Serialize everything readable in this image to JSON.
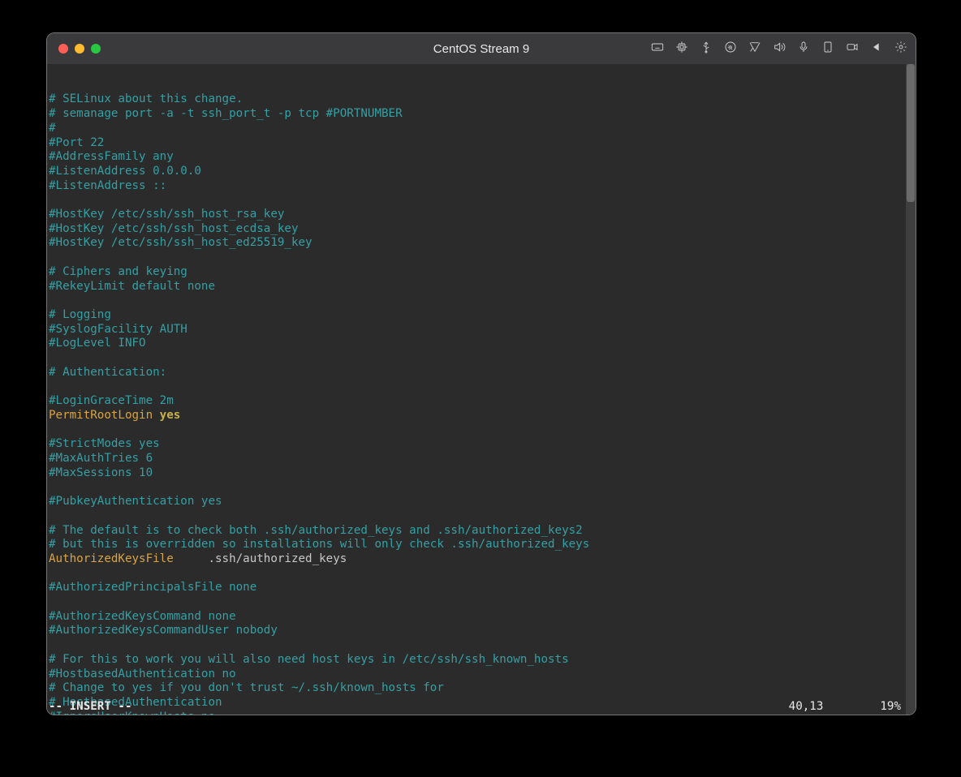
{
  "window": {
    "title": "CentOS Stream 9"
  },
  "toolbar": {
    "icons": [
      "keyboard-icon",
      "cpu-icon",
      "usb-icon",
      "disc-icon",
      "network-icon",
      "speaker-icon",
      "mic-icon",
      "tablet-icon",
      "camera-icon",
      "play-left-icon",
      "gear-icon"
    ]
  },
  "editor": {
    "lines": [
      {
        "t": "comment",
        "text": "# SELinux about this change."
      },
      {
        "t": "comment",
        "text": "# semanage port -a -t ssh_port_t -p tcp #PORTNUMBER"
      },
      {
        "t": "comment",
        "text": "#"
      },
      {
        "t": "comment",
        "text": "#Port 22"
      },
      {
        "t": "comment",
        "text": "#AddressFamily any"
      },
      {
        "t": "comment",
        "text": "#ListenAddress 0.0.0.0"
      },
      {
        "t": "comment",
        "text": "#ListenAddress ::"
      },
      {
        "t": "blank",
        "text": ""
      },
      {
        "t": "comment",
        "text": "#HostKey /etc/ssh/ssh_host_rsa_key"
      },
      {
        "t": "comment",
        "text": "#HostKey /etc/ssh/ssh_host_ecdsa_key"
      },
      {
        "t": "comment",
        "text": "#HostKey /etc/ssh/ssh_host_ed25519_key"
      },
      {
        "t": "blank",
        "text": ""
      },
      {
        "t": "comment",
        "text": "# Ciphers and keying"
      },
      {
        "t": "comment",
        "text": "#RekeyLimit default none"
      },
      {
        "t": "blank",
        "text": ""
      },
      {
        "t": "comment",
        "text": "# Logging"
      },
      {
        "t": "comment",
        "text": "#SyslogFacility AUTH"
      },
      {
        "t": "comment",
        "text": "#LogLevel INFO"
      },
      {
        "t": "blank",
        "text": ""
      },
      {
        "t": "comment",
        "text": "# Authentication:"
      },
      {
        "t": "blank",
        "text": ""
      },
      {
        "t": "comment",
        "text": "#LoginGraceTime 2m"
      },
      {
        "t": "kv",
        "key": "PermitRootLogin ",
        "val": "yes"
      },
      {
        "t": "blank",
        "text": ""
      },
      {
        "t": "comment",
        "text": "#StrictModes yes"
      },
      {
        "t": "comment",
        "text": "#MaxAuthTries 6"
      },
      {
        "t": "comment",
        "text": "#MaxSessions 10"
      },
      {
        "t": "blank",
        "text": ""
      },
      {
        "t": "comment",
        "text": "#PubkeyAuthentication yes"
      },
      {
        "t": "blank",
        "text": ""
      },
      {
        "t": "comment",
        "text": "# The default is to check both .ssh/authorized_keys and .ssh/authorized_keys2"
      },
      {
        "t": "comment",
        "text": "# but this is overridden so installations will only check .ssh/authorized_keys"
      },
      {
        "t": "kv",
        "key": "AuthorizedKeysFile",
        "val": "     .ssh/authorized_keys",
        "plainval": true
      },
      {
        "t": "blank",
        "text": ""
      },
      {
        "t": "comment",
        "text": "#AuthorizedPrincipalsFile none"
      },
      {
        "t": "blank",
        "text": ""
      },
      {
        "t": "comment",
        "text": "#AuthorizedKeysCommand none"
      },
      {
        "t": "comment",
        "text": "#AuthorizedKeysCommandUser nobody"
      },
      {
        "t": "blank",
        "text": ""
      },
      {
        "t": "comment",
        "text": "# For this to work you will also need host keys in /etc/ssh/ssh_known_hosts"
      },
      {
        "t": "comment",
        "text": "#HostbasedAuthentication no"
      },
      {
        "t": "comment",
        "text": "# Change to yes if you don't trust ~/.ssh/known_hosts for"
      },
      {
        "t": "comment",
        "text": "# HostbasedAuthentication"
      },
      {
        "t": "comment",
        "text": "#IgnoreUserKnownHosts no"
      }
    ],
    "status": {
      "mode": "-- INSERT --",
      "position": "40,13",
      "percent": "19%"
    }
  }
}
